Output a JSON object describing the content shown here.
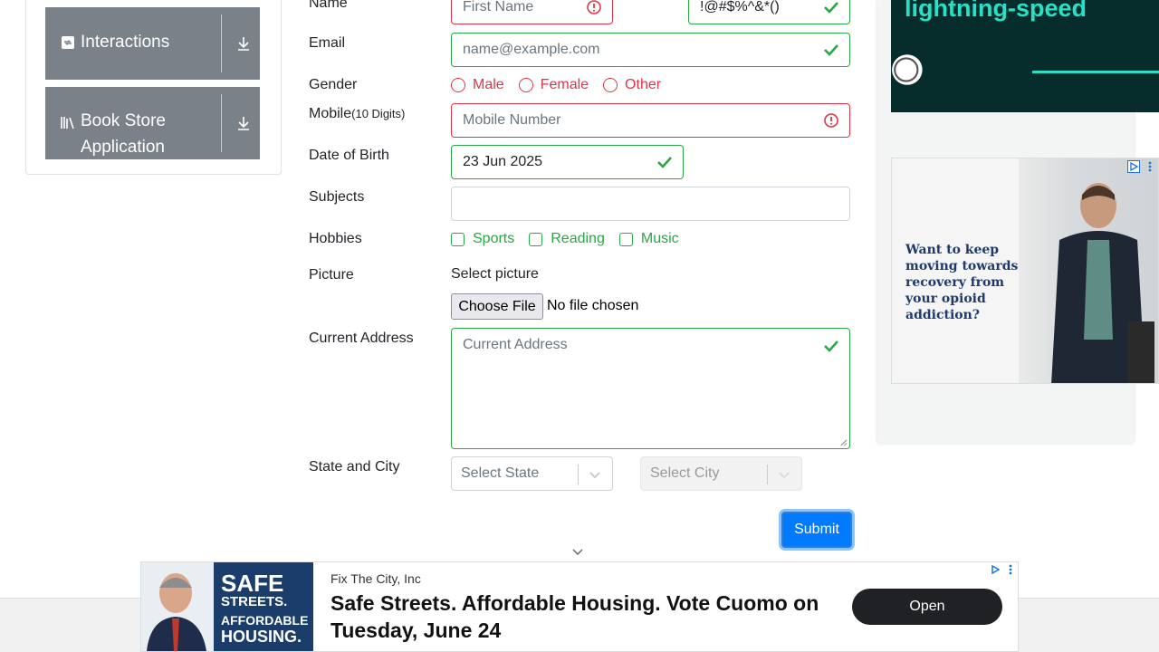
{
  "sidebar": {
    "groups": [
      {
        "label": "Interactions"
      },
      {
        "label": "Book Store Application"
      }
    ]
  },
  "form": {
    "name_label": "Name",
    "first_name_placeholder": "First Name",
    "last_name_value": "!@#$%^&*()",
    "email_label": "Email",
    "email_placeholder": "name@example.com",
    "gender_label": "Gender",
    "gender_options": [
      "Male",
      "Female",
      "Other"
    ],
    "mobile_label": "Mobile",
    "mobile_hint": "(10 Digits)",
    "mobile_placeholder": "Mobile Number",
    "dob_label": "Date of Birth",
    "dob_value": "23 Jun 2025",
    "subjects_label": "Subjects",
    "hobbies_label": "Hobbies",
    "hobbies_options": [
      "Sports",
      "Reading",
      "Music"
    ],
    "picture_label": "Picture",
    "select_picture": "Select picture",
    "choose_file": "Choose File",
    "no_file": "No file chosen",
    "address_label": "Current Address",
    "address_placeholder": "Current Address",
    "state_city_label": "State and City",
    "state_placeholder": "Select State",
    "city_placeholder": "Select City",
    "submit_label": "Submit"
  },
  "ads": {
    "right_top_headline": "lightning-speed",
    "right_mid_text": "Want to keep moving towards recovery from your opioid addiction?",
    "bottom": {
      "sponsor": "Fix The City, Inc",
      "title": "Safe Streets. Affordable Housing. Vote Cuomo on Tuesday, June 24",
      "cta": "Open",
      "image_text_1": "SAFE",
      "image_text_2": "STREETS.",
      "image_text_3": "AFFORDABLE",
      "image_text_4": "HOUSING."
    }
  },
  "colors": {
    "invalid": "#dc3545",
    "valid": "#28a745",
    "primary": "#007bff",
    "sidebar_group": "#7b8189"
  }
}
